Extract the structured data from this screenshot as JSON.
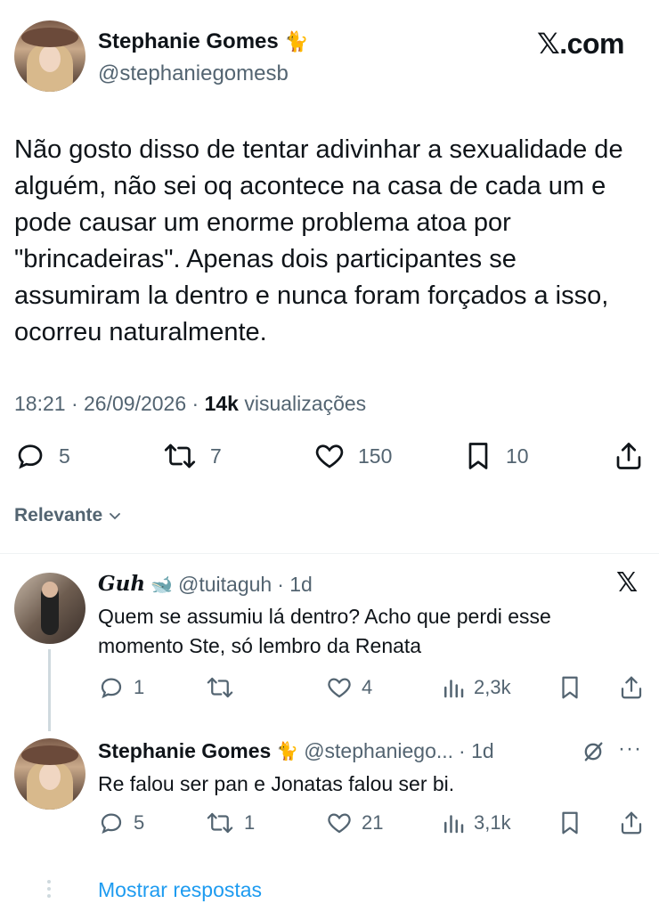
{
  "tweet": {
    "author_name": "Stephanie Gomes",
    "author_emoji": "🐈",
    "handle": "@stephaniegomesb",
    "site": "𝕏.com",
    "text": "Não gosto disso de tentar adivinhar a sexualidade de alguém, não sei oq acontece na casa de cada um e pode causar um enorme problema atoa por \"brincadeiras\". Apenas dois participantes se assumiram la dentro e nunca foram forçados a isso, ocorreu naturalmente.",
    "time": "18:21",
    "date": "26/09/2026",
    "views_count": "14k",
    "views_label": "visualizações",
    "sep": "·",
    "stats": {
      "replies": "5",
      "retweets": "7",
      "likes": "150",
      "bookmarks": "10"
    }
  },
  "sort": {
    "label": "Relevante"
  },
  "replies": [
    {
      "name": "Guh",
      "emoji": "🐋",
      "handle": "@tuitaguh",
      "age": "· 1d",
      "badge": "𝕏",
      "text": "Quem se assumiu lá dentro? Acho que perdi esse momento Ste, só lembro da Renata",
      "stats": {
        "replies": "1",
        "retweets": "",
        "likes": "4",
        "views": "2,3k"
      }
    },
    {
      "name": "Stephanie Gomes",
      "emoji": "🐈",
      "handle": "@stephaniego...",
      "age": "· 1d",
      "more": "···",
      "text": "Re falou ser pan e Jonatas falou ser bi.",
      "stats": {
        "replies": "5",
        "retweets": "1",
        "likes": "21",
        "views": "3,1k"
      }
    }
  ],
  "show_replies": "Mostrar respostas"
}
